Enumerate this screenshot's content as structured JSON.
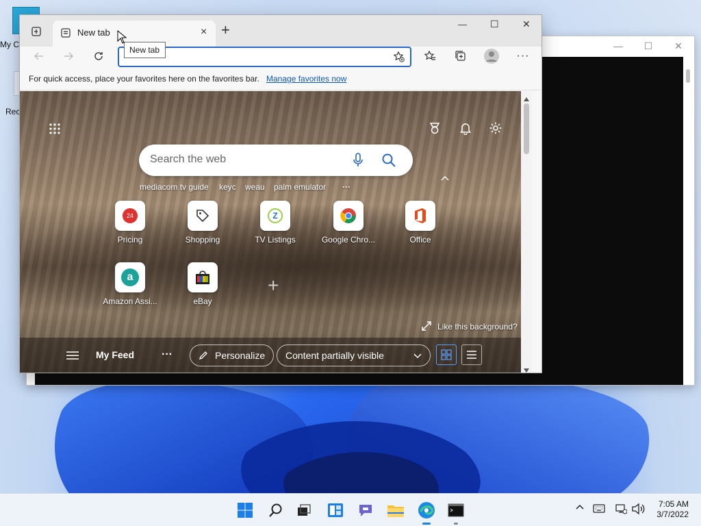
{
  "desktop": {
    "icons": [
      {
        "label": "My C",
        "icon": "folder-icon"
      },
      {
        "label": "Rec",
        "icon": "recycle-bin-icon"
      }
    ]
  },
  "browser": {
    "tab": {
      "title": "New tab",
      "close": "×"
    },
    "new_tab_label": "+",
    "tooltip": "New tab",
    "window_controls": {
      "minimize": "—",
      "maximize": "☐",
      "close": "✕"
    },
    "address": {
      "value": "",
      "placeholder": ""
    },
    "favorites_bar": {
      "message": "For quick access, place your favorites here on the favorites bar.",
      "link": "Manage favorites now"
    }
  },
  "newtab": {
    "search_placeholder": "Search the web",
    "quick_searches": [
      "mediacom tv guide",
      "keyc",
      "weau",
      "palm emulator"
    ],
    "more_dots": "···",
    "tiles": [
      {
        "label": "Pricing",
        "icon": "pricing-icon",
        "badge": "24"
      },
      {
        "label": "Shopping",
        "icon": "shopping-tag-icon"
      },
      {
        "label": "TV Listings",
        "icon": "tv-listings-icon"
      },
      {
        "label": "Google Chro...",
        "icon": "chrome-icon"
      },
      {
        "label": "Office",
        "icon": "office-icon"
      },
      {
        "label": "Amazon Assi...",
        "icon": "amazon-icon"
      },
      {
        "label": "eBay",
        "icon": "ebay-icon"
      }
    ],
    "add_tile": "+",
    "like_background": "Like this background?",
    "feed": {
      "title": "My Feed",
      "dots": "···",
      "personalize": "Personalize",
      "content_visibility": "Content partially visible"
    }
  },
  "console": {
    "controls": {
      "minimize": "—",
      "maximize": "☐",
      "close": "✕"
    }
  },
  "taskbar": {
    "apps": [
      "start-icon",
      "search-icon",
      "task-view-icon",
      "widgets-icon",
      "chat-icon",
      "file-explorer-icon",
      "edge-icon",
      "terminal-icon"
    ],
    "tray": {
      "chevron": "^"
    },
    "time": "7:05 AM",
    "date": "3/7/2022"
  },
  "colors": {
    "accent": "#2a66c8",
    "link": "#0b57c2",
    "taskbar_bg": "#eef2f9",
    "wallpaper_blue": "#1e4fd8"
  }
}
